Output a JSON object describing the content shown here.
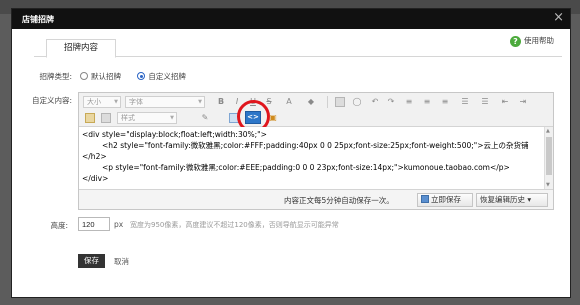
{
  "dialog": {
    "title": "店铺招牌",
    "close_label": "×"
  },
  "tabs": [
    {
      "label": "招牌内容"
    }
  ],
  "help": {
    "label": "使用帮助"
  },
  "form": {
    "type_label": "招牌类型:",
    "type_options": [
      {
        "label": "默认招牌",
        "selected": false
      },
      {
        "label": "自定义招牌",
        "selected": true
      }
    ],
    "content_label": "自定义内容:",
    "height_label": "高度:",
    "height_value": "120",
    "height_unit": "px",
    "height_hint": "宽度为950像素，高度建议不超过120像素，否则导航显示可能异常"
  },
  "editor": {
    "toolbar": {
      "fontsize_placeholder": "大小",
      "fontfamily_placeholder": "字体",
      "style_placeholder": "样式",
      "source_button_label": "<>"
    },
    "code_lines": [
      "<div style=\"display:block;float:left;width:30%;\">",
      "<h2 style=\"font-family:微软雅黑;color:#FFF;padding:40px 0 0 25px;font-size:25px;font-weight:500;\">云上の杂货铺",
      "</h2>",
      "<p style=\"font-family:微软雅黑;color:#EEE;padding:0 0 0 23px;font-size:14px;\">kumonoue.taobao.com</p>",
      "</div>"
    ],
    "autosave_text": "内容正文每5分钟自动保存一次。",
    "save_now_label": "立即保存",
    "restore_label": "恢复编辑历史 ▾"
  },
  "actions": {
    "save_label": "保存",
    "cancel_label": "取消"
  },
  "colors": {
    "title_bar": "#111111",
    "accent": "#2d76c8",
    "highlight_ring": "#e0161d",
    "help_icon": "#4caa3c"
  }
}
